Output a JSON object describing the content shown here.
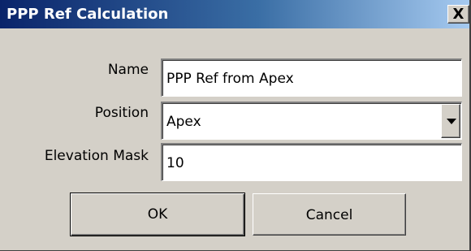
{
  "window": {
    "title": "PPP Ref Calculation",
    "close_label": "X"
  },
  "form": {
    "name_label": "Name",
    "name_value": "PPP Ref from Apex",
    "position_label": "Position",
    "position_value": "Apex",
    "elevation_label": "Elevation Mask",
    "elevation_value": "10"
  },
  "buttons": {
    "ok_label": "OK",
    "cancel_label": "Cancel"
  },
  "colors": {
    "title_gradient_start": "#0a246a",
    "title_gradient_end": "#a6caf0",
    "dialog_face": "#d4d0c8"
  }
}
